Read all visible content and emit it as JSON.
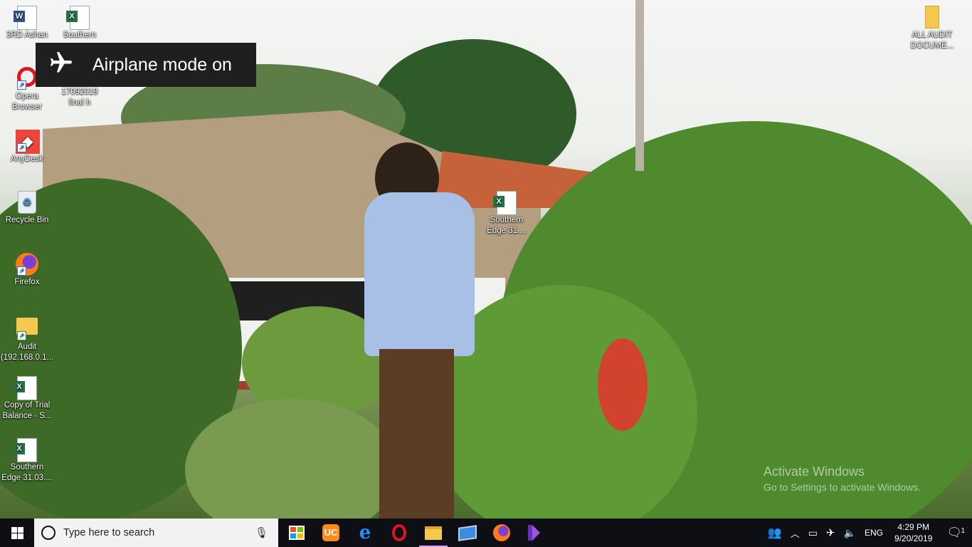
{
  "desktop_icons": [
    {
      "id": "word",
      "label": "3RD Ashan"
    },
    {
      "id": "excel1",
      "label": "Southern"
    },
    {
      "id": "opera",
      "label": "Opera Browser"
    },
    {
      "id": "file1",
      "label": "17092019 final h"
    },
    {
      "id": "anydesk",
      "label": "AnyDesk"
    },
    {
      "id": "recycle",
      "label": "Recycle Bin"
    },
    {
      "id": "firefox",
      "label": "Firefox"
    },
    {
      "id": "audit",
      "label": "Audit (192.168.0.1..."
    },
    {
      "id": "trial",
      "label": "Copy of Trial Balance - S..."
    },
    {
      "id": "southern2",
      "label": "Southern Edge 31.03...."
    },
    {
      "id": "southern3",
      "label": "Southern Edge 31...."
    },
    {
      "id": "allaudit",
      "label": "ALL AUDIT DOCUME..."
    }
  ],
  "toast": {
    "icon": "airplane-icon",
    "text": "Airplane mode on"
  },
  "watermark": {
    "title": "Activate Windows",
    "subtitle": "Go to Settings to activate Windows."
  },
  "taskbar": {
    "search_placeholder": "Type here to search",
    "apps": [
      {
        "name": "store-icon"
      },
      {
        "name": "uc-browser-icon"
      },
      {
        "name": "edge-icon"
      },
      {
        "name": "opera-icon"
      },
      {
        "name": "file-explorer-icon"
      },
      {
        "name": "anydesk-pc-icon"
      },
      {
        "name": "firefox-icon"
      },
      {
        "name": "visual-studio-icon"
      }
    ],
    "tray": {
      "language": "ENG",
      "time": "4:29 PM",
      "date": "9/20/2019",
      "notification_count": "1"
    }
  }
}
